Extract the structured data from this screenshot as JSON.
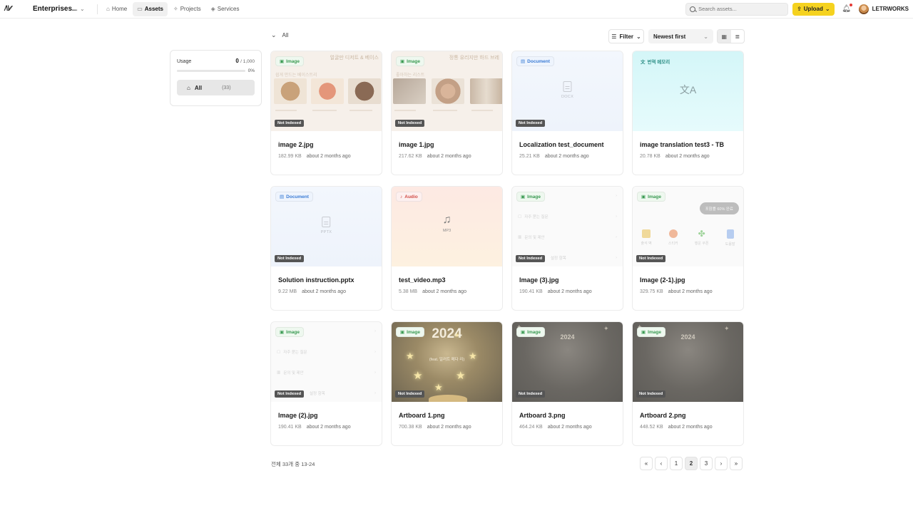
{
  "app": {
    "logo_text": "/\\\\∕∕",
    "workspace": "Enterprises...",
    "nav": [
      {
        "label": "Home"
      },
      {
        "label": "Assets"
      },
      {
        "label": "Projects"
      },
      {
        "label": "Services"
      }
    ],
    "search_placeholder": "Search assets...",
    "upload_label": "Upload",
    "username": "LETRWORKS"
  },
  "toolbar": {
    "scope_label": "All",
    "filter_label": "Filter",
    "sort_selected": "Newest first"
  },
  "usage": {
    "label": "Usage",
    "used": "0",
    "limit": "/ 1,000",
    "percent_text": "0%",
    "percent_value": 0,
    "all_label": "All",
    "all_count": "(33)"
  },
  "assets": [
    {
      "name": "image 2.jpg",
      "size": "182.99 KB",
      "time": "about 2 months ago",
      "type_badge": "Image",
      "status": "Not Indexed"
    },
    {
      "name": "image 1.jpg",
      "size": "217.62 KB",
      "time": "about 2 months ago",
      "type_badge": "Image",
      "status": "Not Indexed"
    },
    {
      "name": "Localization test_document",
      "size": "25.21 KB",
      "time": "about 2 months ago",
      "type_badge": "Document",
      "status": "Not Indexed",
      "ext": "DOCX"
    },
    {
      "name": "image translation test3 - TB",
      "size": "20.78 KB",
      "time": "about 2 months ago",
      "type_badge": "번역 메모리",
      "status": ""
    },
    {
      "name": "Solution instruction.pptx",
      "size": "9.22 MB",
      "time": "about 2 months ago",
      "type_badge": "Document",
      "status": "Not Indexed",
      "ext": "PPTX"
    },
    {
      "name": "test_video.mp3",
      "size": "5.38 MB",
      "time": "about 2 months ago",
      "type_badge": "Audio",
      "status": "",
      "ext": "MP3"
    },
    {
      "name": "Image (3).jpg",
      "size": "190.41 KB",
      "time": "about 2 months ago",
      "type_badge": "Image",
      "status": "Not Indexed"
    },
    {
      "name": "Image (2-1).jpg",
      "size": "329.75 KB",
      "time": "about 2 months ago",
      "type_badge": "Image",
      "status": "Not Indexed"
    },
    {
      "name": "Image (2).jpg",
      "size": "190.41 KB",
      "time": "about 2 months ago",
      "type_badge": "Image",
      "status": "Not Indexed"
    },
    {
      "name": "Artboard 1.png",
      "size": "700.38 KB",
      "time": "about 2 months ago",
      "type_badge": "Image",
      "status": "Not Indexed"
    },
    {
      "name": "Artboard 3.png",
      "size": "464.24 KB",
      "time": "about 2 months ago",
      "type_badge": "Image",
      "status": "Not Indexed"
    },
    {
      "name": "Artboard 2.png",
      "size": "448.52 KB",
      "time": "about 2 months ago",
      "type_badge": "Image",
      "status": "Not Indexed"
    }
  ],
  "thumb_text": {
    "food1_title": "얼굴만 디저트 & 베이스",
    "food1_sub": "쉽게 만드는 베이스트리",
    "food2_title": "정통 유리지만 하드 브레",
    "food2_sub": "좋아하는 리스트",
    "ui_rows": [
      "자주 묻는 질문",
      "문의 및 제안",
      "설정 항목"
    ],
    "ui2_chip": "포함률 60% 완료",
    "ui2_icons": [
      "출석 벽",
      "스티커",
      "행운 쿠폰",
      "도움말"
    ],
    "year": "2024",
    "artboard1_sub": "(feat. 일러트 메다 리)"
  },
  "pagination": {
    "summary": "전체 33개 중 13-24",
    "first": "«",
    "prev": "‹",
    "pages": [
      "1",
      "2",
      "3"
    ],
    "current": "2",
    "next": "›",
    "last": "»"
  },
  "colors": {
    "accent_upload": "#f5d21f",
    "badge_image": "#3a9a52",
    "badge_document": "#3a7bd5",
    "badge_audio": "#d14b45",
    "badge_memory": "#2e8f86"
  }
}
